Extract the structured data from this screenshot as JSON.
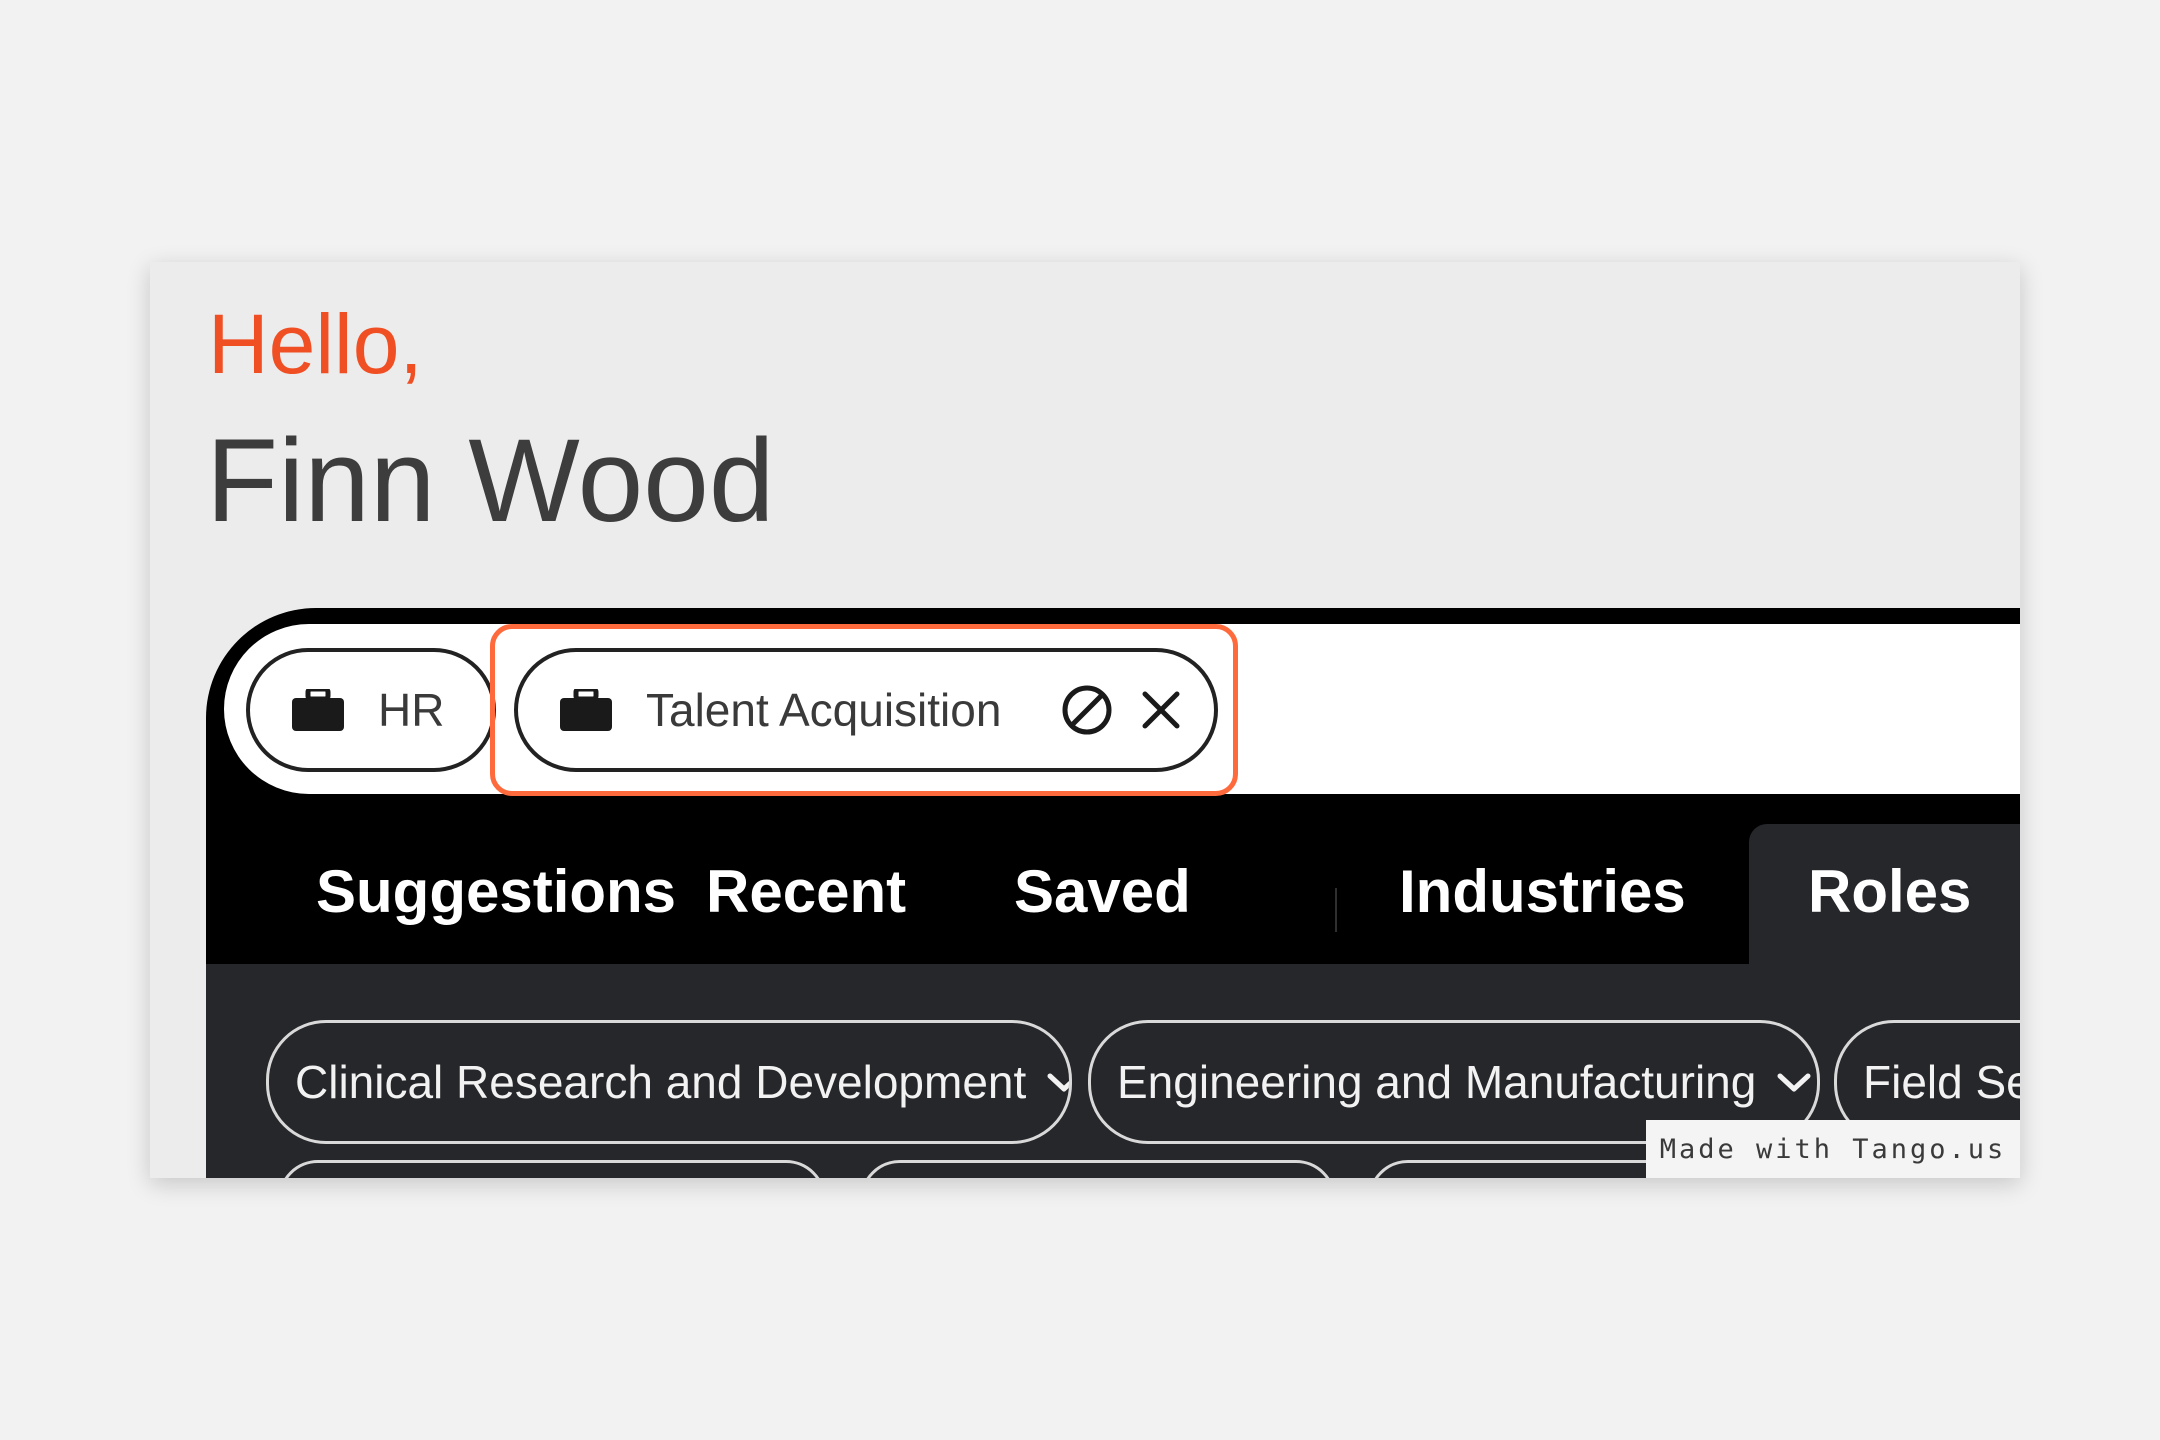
{
  "greeting": {
    "hello": "Hello,",
    "name": "Finn Wood"
  },
  "search": {
    "chips": [
      {
        "label": "HR",
        "icon": "briefcase-icon"
      },
      {
        "label": "Talent Acquisition",
        "icon": "briefcase-icon",
        "actions": [
          "block-icon",
          "close-icon"
        ]
      }
    ]
  },
  "tabs": [
    {
      "label": "Suggestions",
      "active": false
    },
    {
      "label": "Recent",
      "active": false
    },
    {
      "label": "Saved",
      "active": false
    },
    {
      "label": "Industries",
      "active": false
    },
    {
      "label": "Roles",
      "active": true
    }
  ],
  "role_filters": [
    {
      "label": "Clinical Research and Development"
    },
    {
      "label": "Engineering and Manufacturing"
    },
    {
      "label": "Field Ser"
    }
  ],
  "watermark": "Made with Tango.us",
  "colors": {
    "accent": "#f04e23",
    "highlight": "#ff6a3c",
    "panel_dark": "#000000",
    "content_dark": "#26272b"
  }
}
